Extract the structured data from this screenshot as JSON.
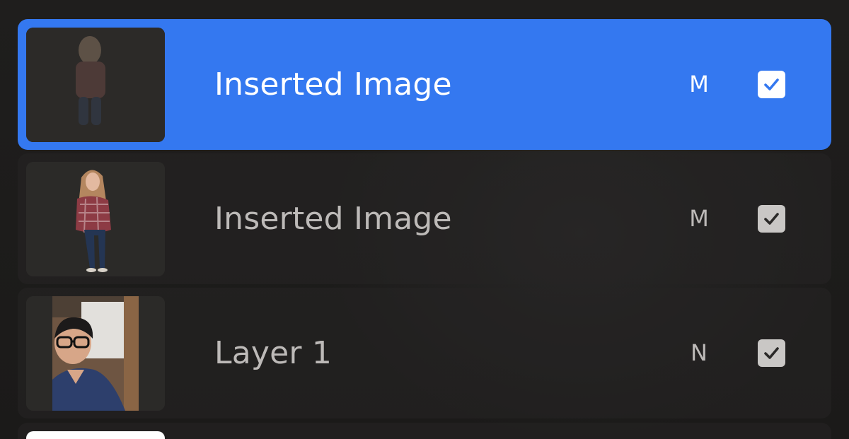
{
  "layers": [
    {
      "name": "Inserted Image",
      "blend_mode": "M",
      "visible": true,
      "selected": true,
      "thumbnail_icon": "faded-figure-thumbnail"
    },
    {
      "name": "Inserted Image",
      "blend_mode": "M",
      "visible": true,
      "selected": false,
      "thumbnail_icon": "figure-cutout-thumbnail"
    },
    {
      "name": "Layer 1",
      "blend_mode": "N",
      "visible": true,
      "selected": false,
      "thumbnail_icon": "portrait-photo-thumbnail"
    }
  ],
  "next_layer_thumbnail_icon": "white-background-thumbnail",
  "colors": {
    "panel_bg": "#1d1c1b",
    "selected_row": "#3478f0",
    "checkbox_checked": "#ffffff",
    "checkbox_unselected_row": "#c9c7c5",
    "text_selected": "#ffffff",
    "text_normal": "#bdbab8"
  }
}
